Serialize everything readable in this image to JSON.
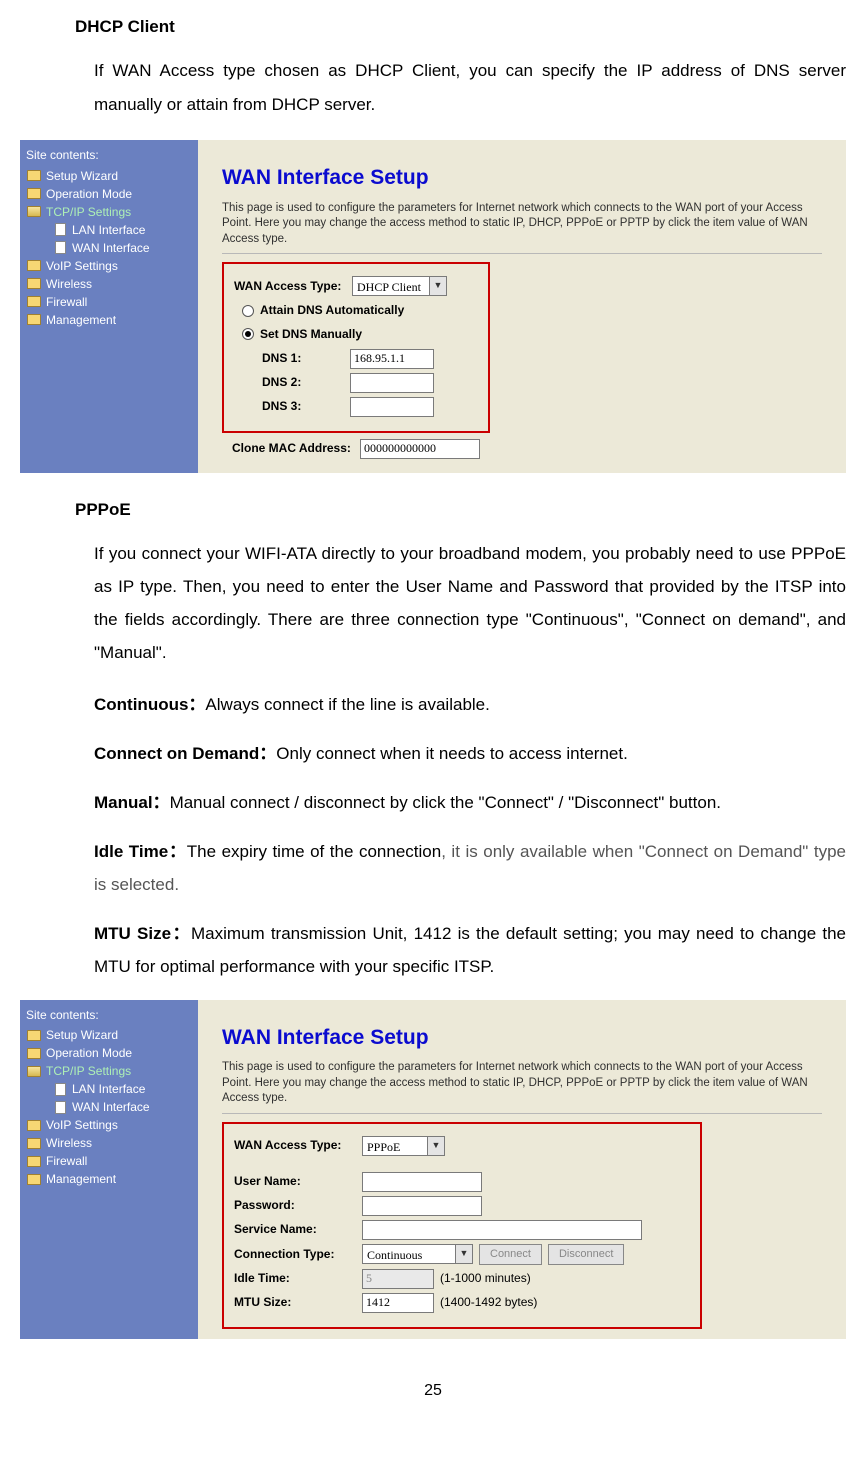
{
  "section1": {
    "head": "DHCP Client",
    "para": "If WAN Access type chosen as DHCP Client, you can specify the IP address of DNS server manually or attain from DHCP server."
  },
  "shot1": {
    "sidebar_title": "Site contents:",
    "tree": [
      {
        "icon": "folder",
        "label": "Setup Wizard"
      },
      {
        "icon": "folder",
        "label": "Operation Mode"
      },
      {
        "icon": "folder-open",
        "label": "TCP/IP Settings",
        "hl": true
      },
      {
        "icon": "doc",
        "label": "LAN Interface",
        "indent": true
      },
      {
        "icon": "doc",
        "label": "WAN Interface",
        "indent": true
      },
      {
        "icon": "folder",
        "label": "VoIP Settings"
      },
      {
        "icon": "folder",
        "label": "Wireless"
      },
      {
        "icon": "folder",
        "label": "Firewall"
      },
      {
        "icon": "folder",
        "label": "Management"
      }
    ],
    "pane_title": "WAN Interface Setup",
    "pane_desc": "This page is used to configure the parameters for Internet network which connects to the WAN port of your Access Point. Here you may change the access method to static IP, DHCP, PPPoE or PPTP by click the item value of WAN Access type.",
    "wan_access_label": "WAN Access Type:",
    "wan_access_value": "DHCP Client",
    "radio1": "Attain DNS Automatically",
    "radio2": "Set DNS Manually",
    "dns1_label": "DNS 1:",
    "dns1_value": "168.95.1.1",
    "dns2_label": "DNS 2:",
    "dns3_label": "DNS 3:",
    "clone_label": "Clone MAC Address:",
    "clone_value": "000000000000"
  },
  "section2": {
    "head": "PPPoE",
    "para": "If you connect your WIFI-ATA directly to your broadband modem, you probably need to use PPPoE as IP type. Then, you need to enter the User Name and Password that provided by the ITSP into the fields accordingly. There are three connection type \"Continuous\", \"Connect on demand\", and \"Manual\".",
    "d1_b": "Continuous：",
    "d1_t": "Always connect if the line is available.",
    "d2_b": "Connect on Demand：",
    "d2_t": "Only connect when it needs to access internet.",
    "d3_b": "Manual：",
    "d3_t": "Manual connect / disconnect by click the \"Connect\" / \"Disconnect\" button.",
    "d4_b": "Idle Time：",
    "d4_t1": "The expiry time of the connection",
    "d4_t2": ", it is only available when \"Connect on Demand\" type is selected.",
    "d5_b": "MTU Size：",
    "d5_t": "Maximum transmission Unit, 1412 is the default setting; you may need to change the MTU for optimal performance with your specific ITSP."
  },
  "shot2": {
    "sidebar_title": "Site contents:",
    "tree": [
      {
        "icon": "folder",
        "label": "Setup Wizard"
      },
      {
        "icon": "folder",
        "label": "Operation Mode"
      },
      {
        "icon": "folder-open",
        "label": "TCP/IP Settings",
        "hl": true
      },
      {
        "icon": "doc",
        "label": "LAN Interface",
        "indent": true
      },
      {
        "icon": "doc",
        "label": "WAN Interface",
        "indent": true
      },
      {
        "icon": "folder",
        "label": "VoIP Settings"
      },
      {
        "icon": "folder",
        "label": "Wireless"
      },
      {
        "icon": "folder",
        "label": "Firewall"
      },
      {
        "icon": "folder",
        "label": "Management"
      }
    ],
    "pane_title": "WAN Interface Setup",
    "pane_desc": "This page is used to configure the parameters for Internet network which connects to the WAN port of your Access Point. Here you may change the access method to static IP, DHCP, PPPoE or PPTP by click the item value of WAN Access type.",
    "wan_access_label": "WAN Access Type:",
    "wan_access_value": "PPPoE",
    "user_label": "User Name:",
    "pass_label": "Password:",
    "svc_label": "Service Name:",
    "conn_label": "Connection Type:",
    "conn_value": "Continuous",
    "btn_connect": "Connect",
    "btn_disconnect": "Disconnect",
    "idle_label": "Idle Time:",
    "idle_value": "5",
    "idle_hint": "(1-1000 minutes)",
    "mtu_label": "MTU Size:",
    "mtu_value": "1412",
    "mtu_hint": "(1400-1492 bytes)"
  },
  "pagenum": "25"
}
